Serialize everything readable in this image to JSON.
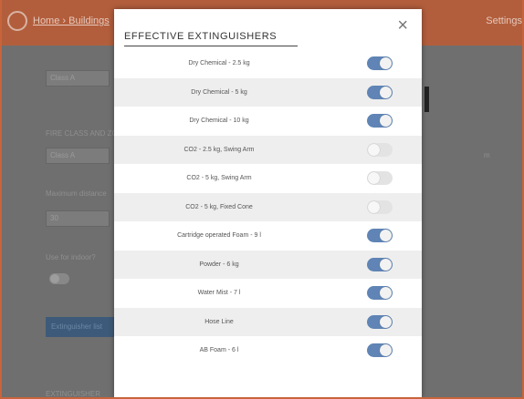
{
  "header": {
    "breadcrumb": "Home › Buildings",
    "settings_label": "Settings"
  },
  "background_form": {
    "select_value": "Class A",
    "field1_label": "FIRE CLASS AND ZONE",
    "field1_value": "Class A",
    "field1_right": "m",
    "field2_label": "Maximum distance",
    "field2_value": "30",
    "toggle_label": "Use for indoor?",
    "button_label": "Extinguisher list",
    "bottom_label": "EXTINGUISHER"
  },
  "modal": {
    "title": "EFFECTIVE EXTINGUISHERS",
    "close_symbol": "×",
    "items": [
      {
        "label": "Dry Chemical - 2.5 kg",
        "enabled": true
      },
      {
        "label": "Dry Chemical - 5 kg",
        "enabled": true
      },
      {
        "label": "Dry Chemical - 10 kg",
        "enabled": true
      },
      {
        "label": "CO2 - 2.5 kg, Swing Arm",
        "enabled": false
      },
      {
        "label": "CO2 - 5 kg, Swing Arm",
        "enabled": false
      },
      {
        "label": "CO2 - 5 kg, Fixed Cone",
        "enabled": false
      },
      {
        "label": "Cartridge operated Foam - 9 l",
        "enabled": true
      },
      {
        "label": "Powder - 6 kg",
        "enabled": true
      },
      {
        "label": "Water Mist - 7 l",
        "enabled": true
      },
      {
        "label": "Hose Line",
        "enabled": true
      },
      {
        "label": "AB Foam - 6 l",
        "enabled": true
      }
    ]
  },
  "colors": {
    "toggle_on": "#5f84b5",
    "toggle_off": "#e3e3e3",
    "topbar": "#b25e3c"
  }
}
